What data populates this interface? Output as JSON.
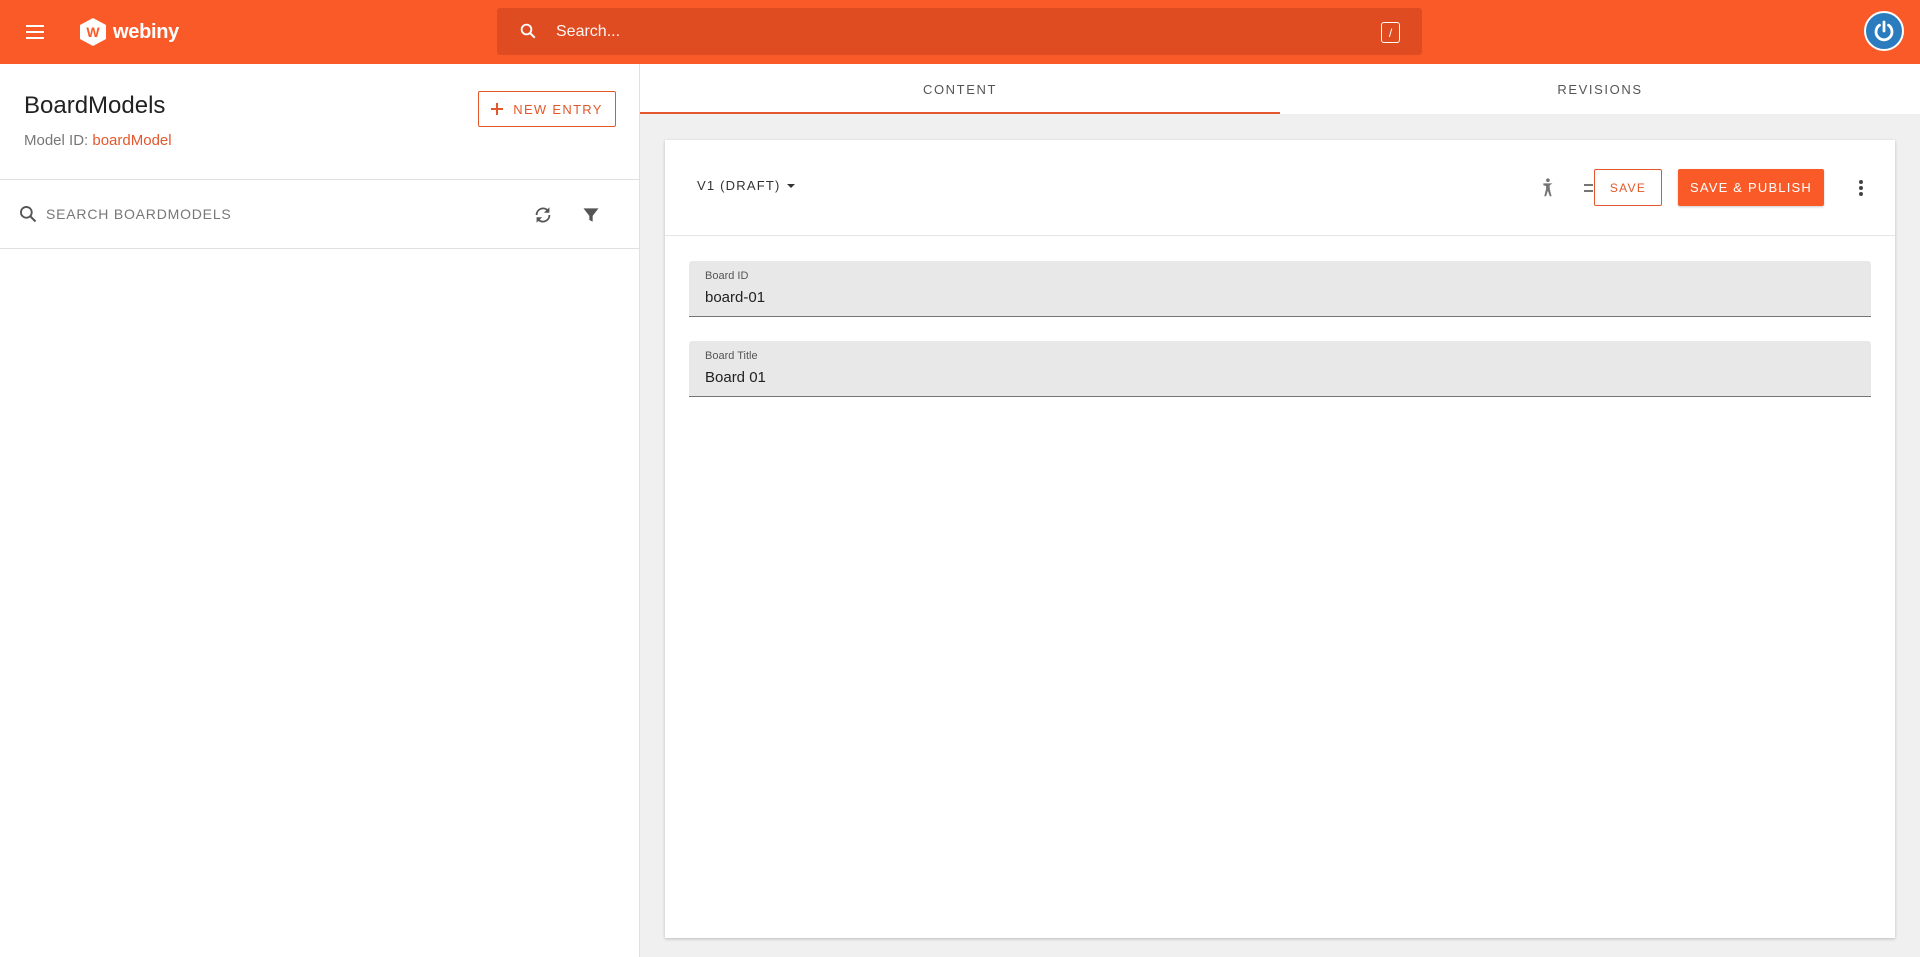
{
  "topbar": {
    "logo_text": "webiny",
    "search_placeholder": "Search...",
    "search_shortcut": "/"
  },
  "left": {
    "title": "BoardModels",
    "model_id_label": "Model ID:",
    "model_id_value": "boardModel",
    "new_entry_label": "NEW ENTRY",
    "search_placeholder": "SEARCH BOARDMODELS"
  },
  "tabs": [
    {
      "label": "CONTENT",
      "active": true
    },
    {
      "label": "REVISIONS",
      "active": false
    }
  ],
  "editor": {
    "revision_label": "V1 (DRAFT)",
    "save_label": "SAVE",
    "publish_label": "SAVE & PUBLISH",
    "fields": [
      {
        "label": "Board ID",
        "value": "board-01"
      },
      {
        "label": "Board Title",
        "value": "Board 01"
      }
    ]
  },
  "colors": {
    "brand": "#fa5a28",
    "accent": "#e2582c",
    "avatar": "#2b7cbf"
  },
  "icons": [
    "menu-icon",
    "webiny-logo-icon",
    "search-icon",
    "power-icon",
    "plus-icon",
    "refresh-icon",
    "filter-icon",
    "accessibility-icon",
    "clear-list-icon",
    "more-vert-icon"
  ]
}
